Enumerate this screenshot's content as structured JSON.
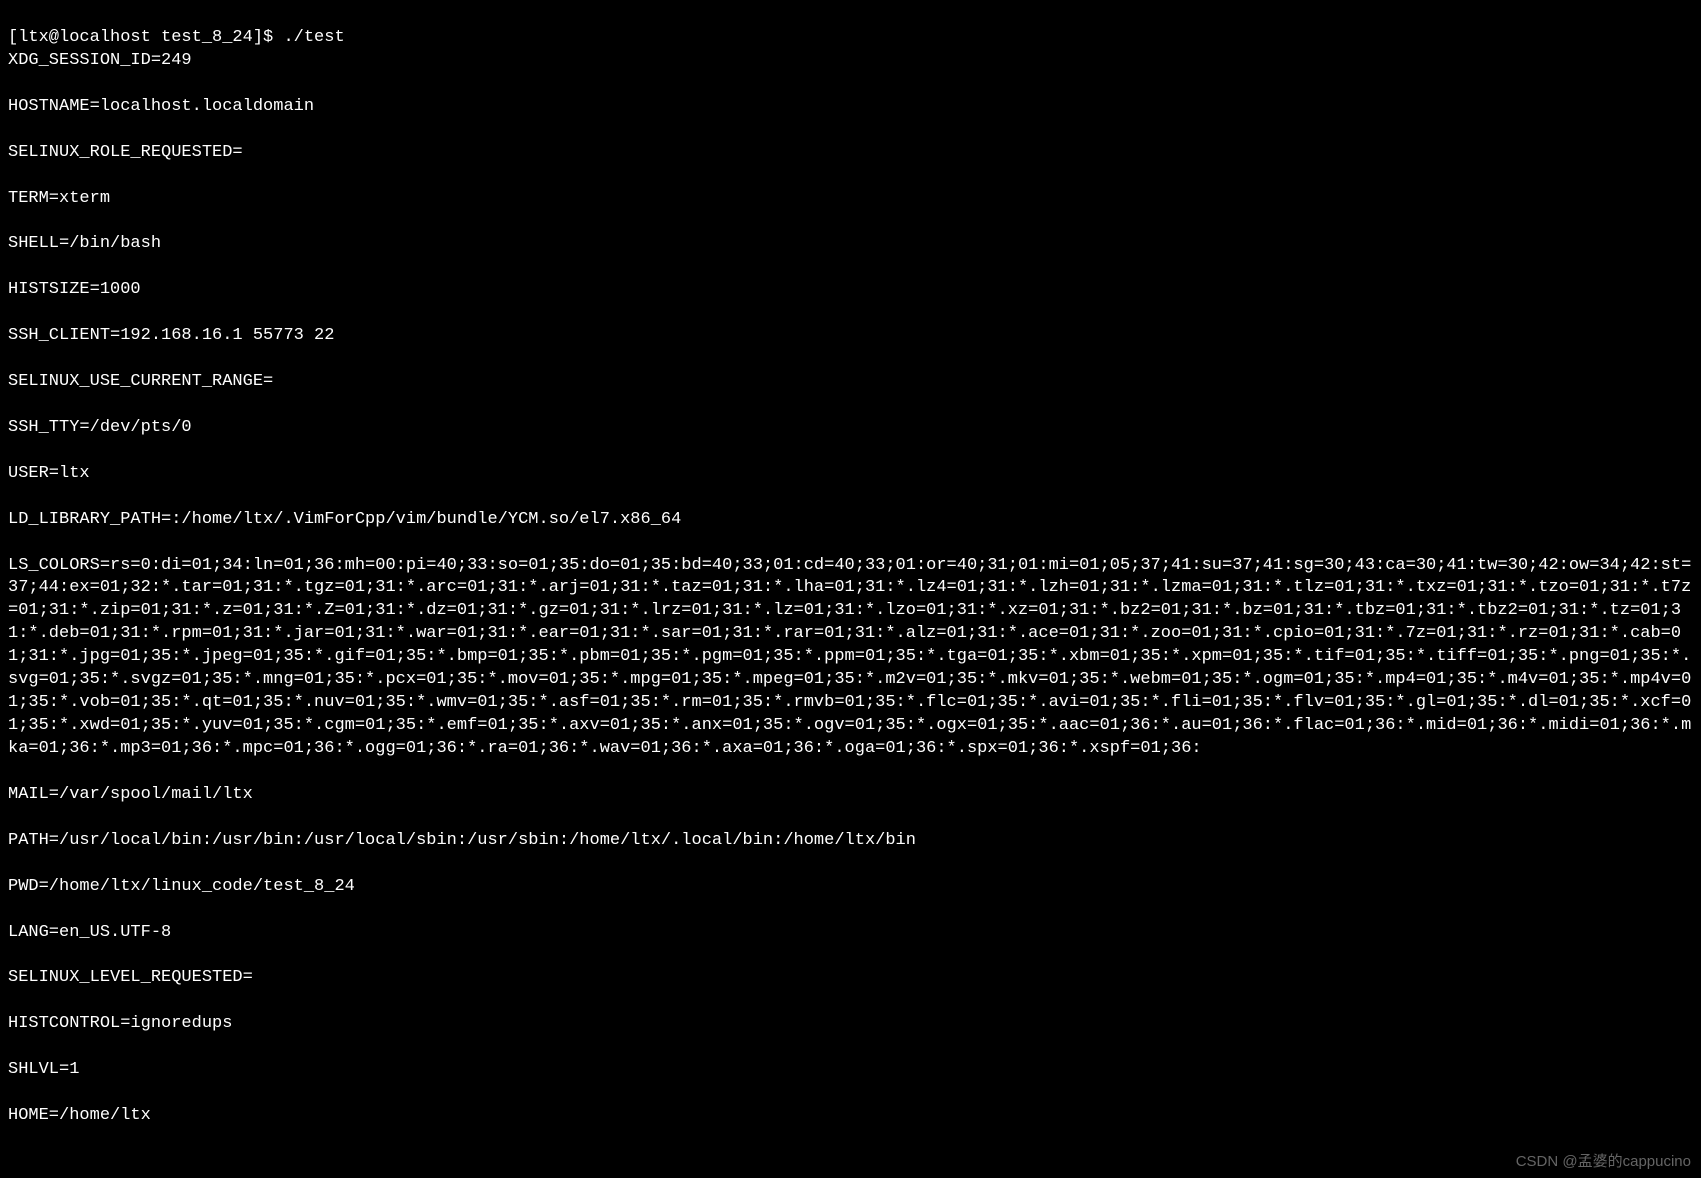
{
  "prompt": "[ltx@localhost test_8_24]$ ",
  "command": "./test",
  "env": {
    "XDG_SESSION_ID": "XDG_SESSION_ID=249",
    "HOSTNAME": "HOSTNAME=localhost.localdomain",
    "SELINUX_ROLE_REQUESTED": "SELINUX_ROLE_REQUESTED=",
    "TERM": "TERM=xterm",
    "SHELL": "SHELL=/bin/bash",
    "HISTSIZE": "HISTSIZE=1000",
    "SSH_CLIENT": "SSH_CLIENT=192.168.16.1 55773 22",
    "SELINUX_USE_CURRENT_RANGE": "SELINUX_USE_CURRENT_RANGE=",
    "SSH_TTY": "SSH_TTY=/dev/pts/0",
    "USER": "USER=ltx",
    "LD_LIBRARY_PATH": "LD_LIBRARY_PATH=:/home/ltx/.VimForCpp/vim/bundle/YCM.so/el7.x86_64",
    "LS_COLORS": "LS_COLORS=rs=0:di=01;34:ln=01;36:mh=00:pi=40;33:so=01;35:do=01;35:bd=40;33;01:cd=40;33;01:or=40;31;01:mi=01;05;37;41:su=37;41:sg=30;43:ca=30;41:tw=30;42:ow=34;42:st=37;44:ex=01;32:*.tar=01;31:*.tgz=01;31:*.arc=01;31:*.arj=01;31:*.taz=01;31:*.lha=01;31:*.lz4=01;31:*.lzh=01;31:*.lzma=01;31:*.tlz=01;31:*.txz=01;31:*.tzo=01;31:*.t7z=01;31:*.zip=01;31:*.z=01;31:*.Z=01;31:*.dz=01;31:*.gz=01;31:*.lrz=01;31:*.lz=01;31:*.lzo=01;31:*.xz=01;31:*.bz2=01;31:*.bz=01;31:*.tbz=01;31:*.tbz2=01;31:*.tz=01;31:*.deb=01;31:*.rpm=01;31:*.jar=01;31:*.war=01;31:*.ear=01;31:*.sar=01;31:*.rar=01;31:*.alz=01;31:*.ace=01;31:*.zoo=01;31:*.cpio=01;31:*.7z=01;31:*.rz=01;31:*.cab=01;31:*.jpg=01;35:*.jpeg=01;35:*.gif=01;35:*.bmp=01;35:*.pbm=01;35:*.pgm=01;35:*.ppm=01;35:*.tga=01;35:*.xbm=01;35:*.xpm=01;35:*.tif=01;35:*.tiff=01;35:*.png=01;35:*.svg=01;35:*.svgz=01;35:*.mng=01;35:*.pcx=01;35:*.mov=01;35:*.mpg=01;35:*.mpeg=01;35:*.m2v=01;35:*.mkv=01;35:*.webm=01;35:*.ogm=01;35:*.mp4=01;35:*.m4v=01;35:*.mp4v=01;35:*.vob=01;35:*.qt=01;35:*.nuv=01;35:*.wmv=01;35:*.asf=01;35:*.rm=01;35:*.rmvb=01;35:*.flc=01;35:*.avi=01;35:*.fli=01;35:*.flv=01;35:*.gl=01;35:*.dl=01;35:*.xcf=01;35:*.xwd=01;35:*.yuv=01;35:*.cgm=01;35:*.emf=01;35:*.axv=01;35:*.anx=01;35:*.ogv=01;35:*.ogx=01;35:*.aac=01;36:*.au=01;36:*.flac=01;36:*.mid=01;36:*.midi=01;36:*.mka=01;36:*.mp3=01;36:*.mpc=01;36:*.ogg=01;36:*.ra=01;36:*.wav=01;36:*.axa=01;36:*.oga=01;36:*.spx=01;36:*.xspf=01;36:",
    "MAIL": "MAIL=/var/spool/mail/ltx",
    "PATH": "PATH=/usr/local/bin:/usr/bin:/usr/local/sbin:/usr/sbin:/home/ltx/.local/bin:/home/ltx/bin",
    "PWD": "PWD=/home/ltx/linux_code/test_8_24",
    "LANG": "LANG=en_US.UTF-8",
    "SELINUX_LEVEL_REQUESTED": "SELINUX_LEVEL_REQUESTED=",
    "HISTCONTROL": "HISTCONTROL=ignoredups",
    "SHLVL": "SHLVL=1",
    "HOME": "HOME=/home/ltx"
  },
  "watermark": "CSDN @孟婆的cappucino"
}
